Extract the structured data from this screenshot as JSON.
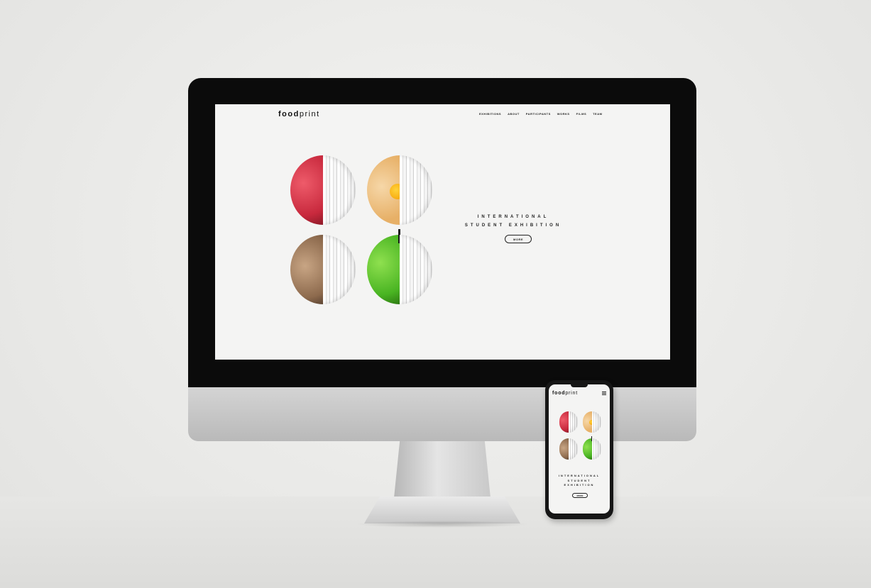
{
  "site": {
    "logo_bold": "food",
    "logo_light": "print",
    "nav": [
      "EXHIBITIONS",
      "ABOUT",
      "PARTICIPANTS",
      "WORKS",
      "FILMS",
      "TEAM"
    ],
    "hero_title": "INTERNATIONAL STUDENT EXHIBITION",
    "more_label": "MORE",
    "artworks": [
      "lychee-half",
      "egg-half",
      "walnut-half",
      "apple-half"
    ]
  },
  "mobile": {
    "logo_bold": "food",
    "logo_light": "print",
    "menu_icon": "hamburger-icon",
    "hero_title": "INTERNATIONAL STUDENT EXHIBITION",
    "more_label": "MORE"
  },
  "colors": {
    "bezel": "#0b0b0b",
    "screen_bg": "#f4f4f3",
    "text": "#222222",
    "lychee": "#d6324a",
    "egg": "#ecbd78",
    "walnut": "#9e7b5c",
    "apple": "#5bc62d"
  }
}
